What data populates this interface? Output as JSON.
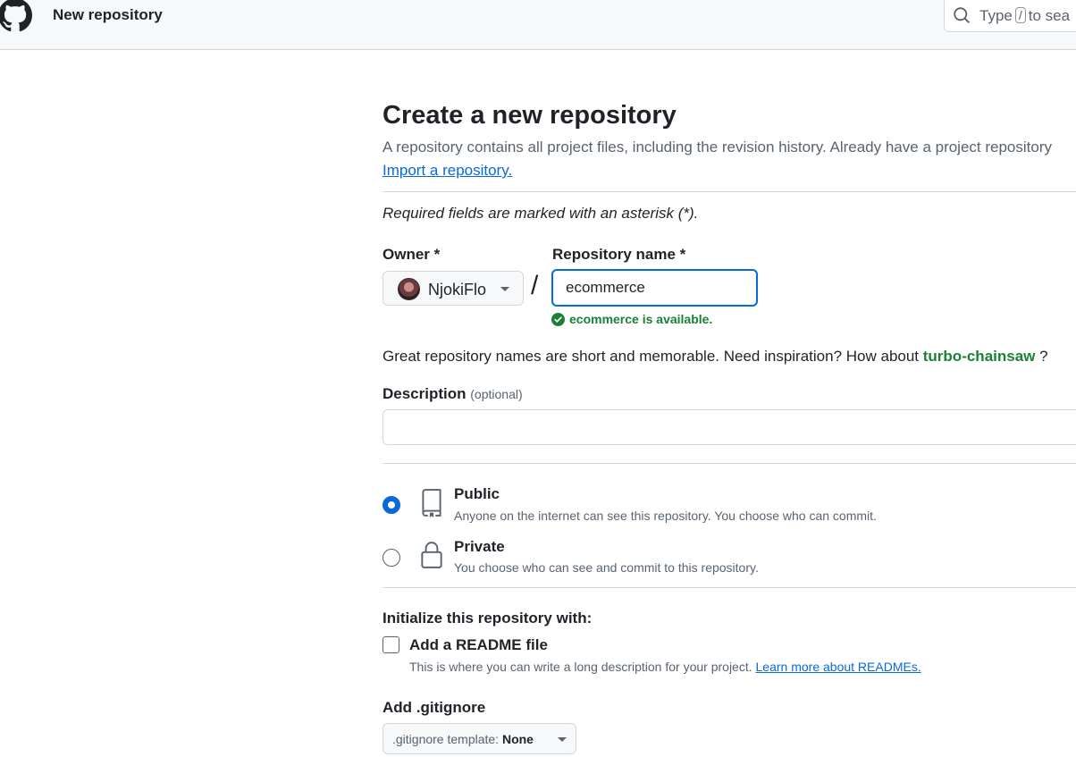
{
  "header": {
    "title": "New repository",
    "logo_icon": "github-mark-icon",
    "search": {
      "prefix": "Type",
      "key": "/",
      "suffix": "to sea"
    }
  },
  "main": {
    "page_title": "Create a new repository",
    "subtitle": "A repository contains all project files, including the revision history. Already have a project repository",
    "import_link": "Import a repository.",
    "required_note": "Required fields are marked with an asterisk (*).",
    "owner": {
      "label": "Owner *",
      "name": "NjokiFlo"
    },
    "slash": "/",
    "repo_name": {
      "label": "Repository name *",
      "value": "ecommerce",
      "availability": "ecommerce is available."
    },
    "suggestion": {
      "text": "Great repository names are short and memorable. Need inspiration? How about",
      "name": "turbo-chainsaw",
      "suffix": "?"
    },
    "description": {
      "label": "Description",
      "optional": "(optional)",
      "value": ""
    },
    "visibility": [
      {
        "title": "Public",
        "desc": "Anyone on the internet can see this repository. You choose who can commit.",
        "icon": "repo-icon",
        "selected": true
      },
      {
        "title": "Private",
        "desc": "You choose who can see and commit to this repository.",
        "icon": "lock-icon",
        "selected": false
      }
    ],
    "initialize": {
      "label": "Initialize this repository with:",
      "readme_label": "Add a README file",
      "readme_desc": "This is where you can write a long description for your project.",
      "readme_link": "Learn more about READMEs."
    },
    "gitignore": {
      "label": "Add .gitignore",
      "button_prefix": ".gitignore template:",
      "button_value": "None"
    }
  },
  "colors": {
    "accent": "#0969da",
    "success": "#1a7f37",
    "muted": "#59636e"
  }
}
